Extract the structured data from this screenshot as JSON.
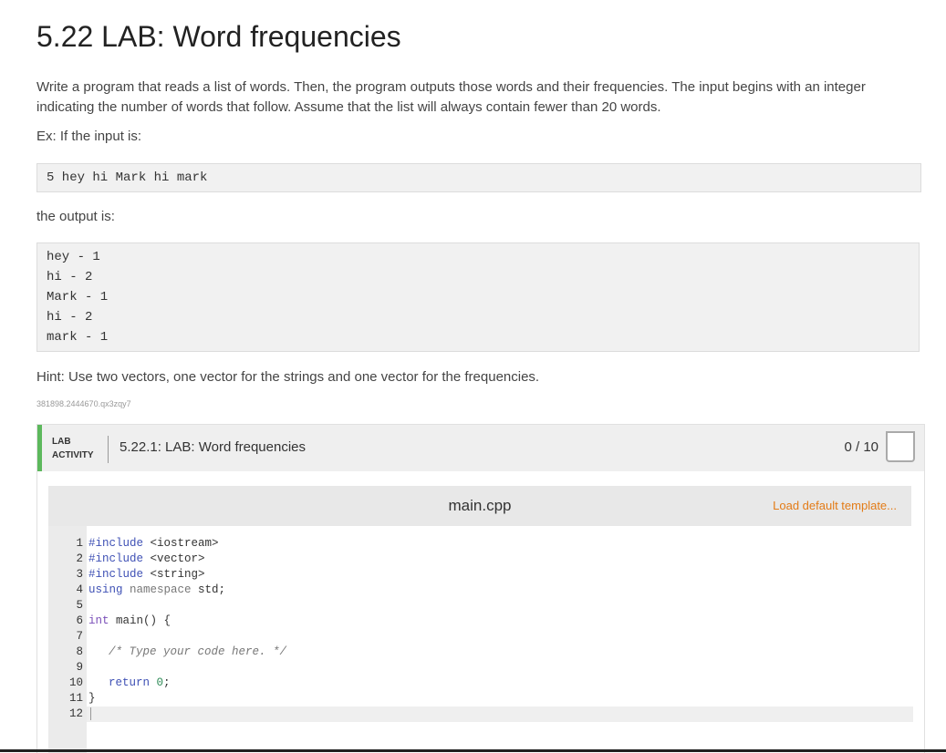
{
  "title": "5.22 LAB: Word frequencies",
  "description_line1": "Write a program that reads a list of words. Then, the program outputs those words and their frequencies. The input begins with an integer",
  "description_line2": "indicating the number of words that follow. Assume that the list will always contain fewer than 20 words.",
  "example_label": "Ex: If the input is:",
  "example_input": "5 hey hi Mark hi mark",
  "output_label": "the output is:",
  "example_output": [
    "hey - 1",
    "hi - 2",
    "Mark - 1",
    "hi - 2",
    "mark - 1"
  ],
  "hint": "Hint: Use two vectors, one vector for the strings and one vector for the frequencies.",
  "tracking_code": "381898.2444670.qx3zqy7",
  "lab": {
    "tag_line1": "LAB",
    "tag_line2": "ACTIVITY",
    "title": "5.22.1: LAB: Word frequencies",
    "score": "0 / 10",
    "accent_color": "#5cb85c"
  },
  "editor": {
    "filename": "main.cpp",
    "load_template": "Load default template...",
    "line_numbers": [
      "1",
      "2",
      "3",
      "4",
      "5",
      "6",
      "7",
      "8",
      "9",
      "10",
      "11",
      "12"
    ],
    "code": {
      "l1_kw": "#include",
      "l1_rest": " <iostream>",
      "l2_kw": "#include",
      "l2_rest": " <vector>",
      "l3_kw": "#include",
      "l3_rest": " <string>",
      "l4_using": "using",
      "l4_ns": " namespace",
      "l4_rest": " std;",
      "l6_type": "int",
      "l6_rest": " main() {",
      "l8_comment": "/* Type your code here. */",
      "l10_ret": "return",
      "l10_num": " 0",
      "l10_semi": ";",
      "l11": "}"
    }
  }
}
